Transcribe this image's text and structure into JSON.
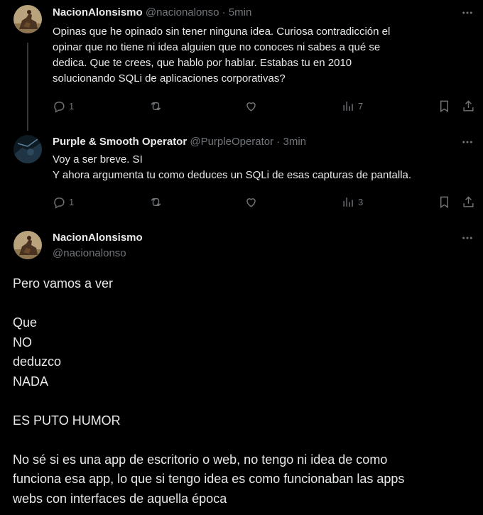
{
  "tweets": [
    {
      "name": "NacionAlonsismo",
      "handle": "@nacionalonso",
      "sep": "·",
      "time": "5min",
      "lines": [
        "Opinas que he opinado sin tener ninguna idea. Curiosa contradicción el",
        "opinar que no tiene ni idea alguien que no conoces ni sabes a qué se",
        "dedica. Que te crees, que hablo por hablar. Estabas tu en 2010",
        "solucionando SQLi de aplicaciones corporativas?"
      ],
      "replies": "1",
      "views": "7"
    },
    {
      "name": "Purple & Smooth Operator",
      "handle": "@PurpleOperator",
      "sep": "·",
      "time": "3min",
      "lines": [
        "Voy a ser breve. SI",
        "Y ahora argumenta tu como deduces un SQLi de esas capturas de pantalla."
      ],
      "replies": "1",
      "views": "3"
    }
  ],
  "main_tweet": {
    "name": "NacionAlonsismo",
    "handle": "@nacionalonso",
    "lines": [
      "Pero vamos a ver",
      "",
      "Que",
      "NO",
      "deduzco",
      "NADA",
      "",
      "ES PUTO HUMOR",
      "",
      "No sé si es una app de escritorio o web, no tengo ni idea de como",
      "funciona esa app, lo que si tengo idea es como funcionaban las apps",
      "webs con interfaces de aquella época"
    ]
  },
  "icons": {
    "more": "more-horizontal-icon",
    "reply": "reply-icon",
    "retweet": "retweet-icon",
    "like": "heart-icon",
    "views": "views-icon",
    "bookmark": "bookmark-icon",
    "share": "share-icon"
  },
  "colors": {
    "background": "#000000",
    "text": "#e7e9ea",
    "muted": "#71767b",
    "thread_line": "#333639"
  }
}
